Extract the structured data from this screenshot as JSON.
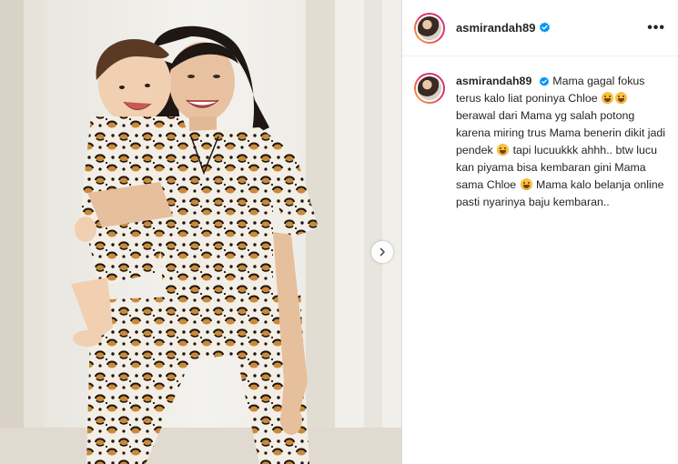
{
  "post": {
    "username": "asmirandah89",
    "verified": true,
    "more_label": "•••",
    "caption": {
      "seg1": "Mama gagal fokus terus kalo liat poninya Chloe",
      "seg2": "berawal dari Mama yg salah potong karena miring trus Mama benerin dikit jadi pendek",
      "seg3": "tapi lucuukkk ahhh.. btw lucu kan piyama bisa kembaran gini Mama sama Chloe",
      "seg4": "Mama kalo belanja online pasti nyarinya baju kembaran.."
    }
  },
  "icons": {
    "verified": "verified-badge-icon",
    "next": "chevron-right-icon",
    "more": "more-horizontal-icon",
    "emoji": "laughing-face-emoji"
  },
  "colors": {
    "verified_blue": "#0095f6",
    "text": "#262626",
    "divider": "#dbdbdb"
  }
}
